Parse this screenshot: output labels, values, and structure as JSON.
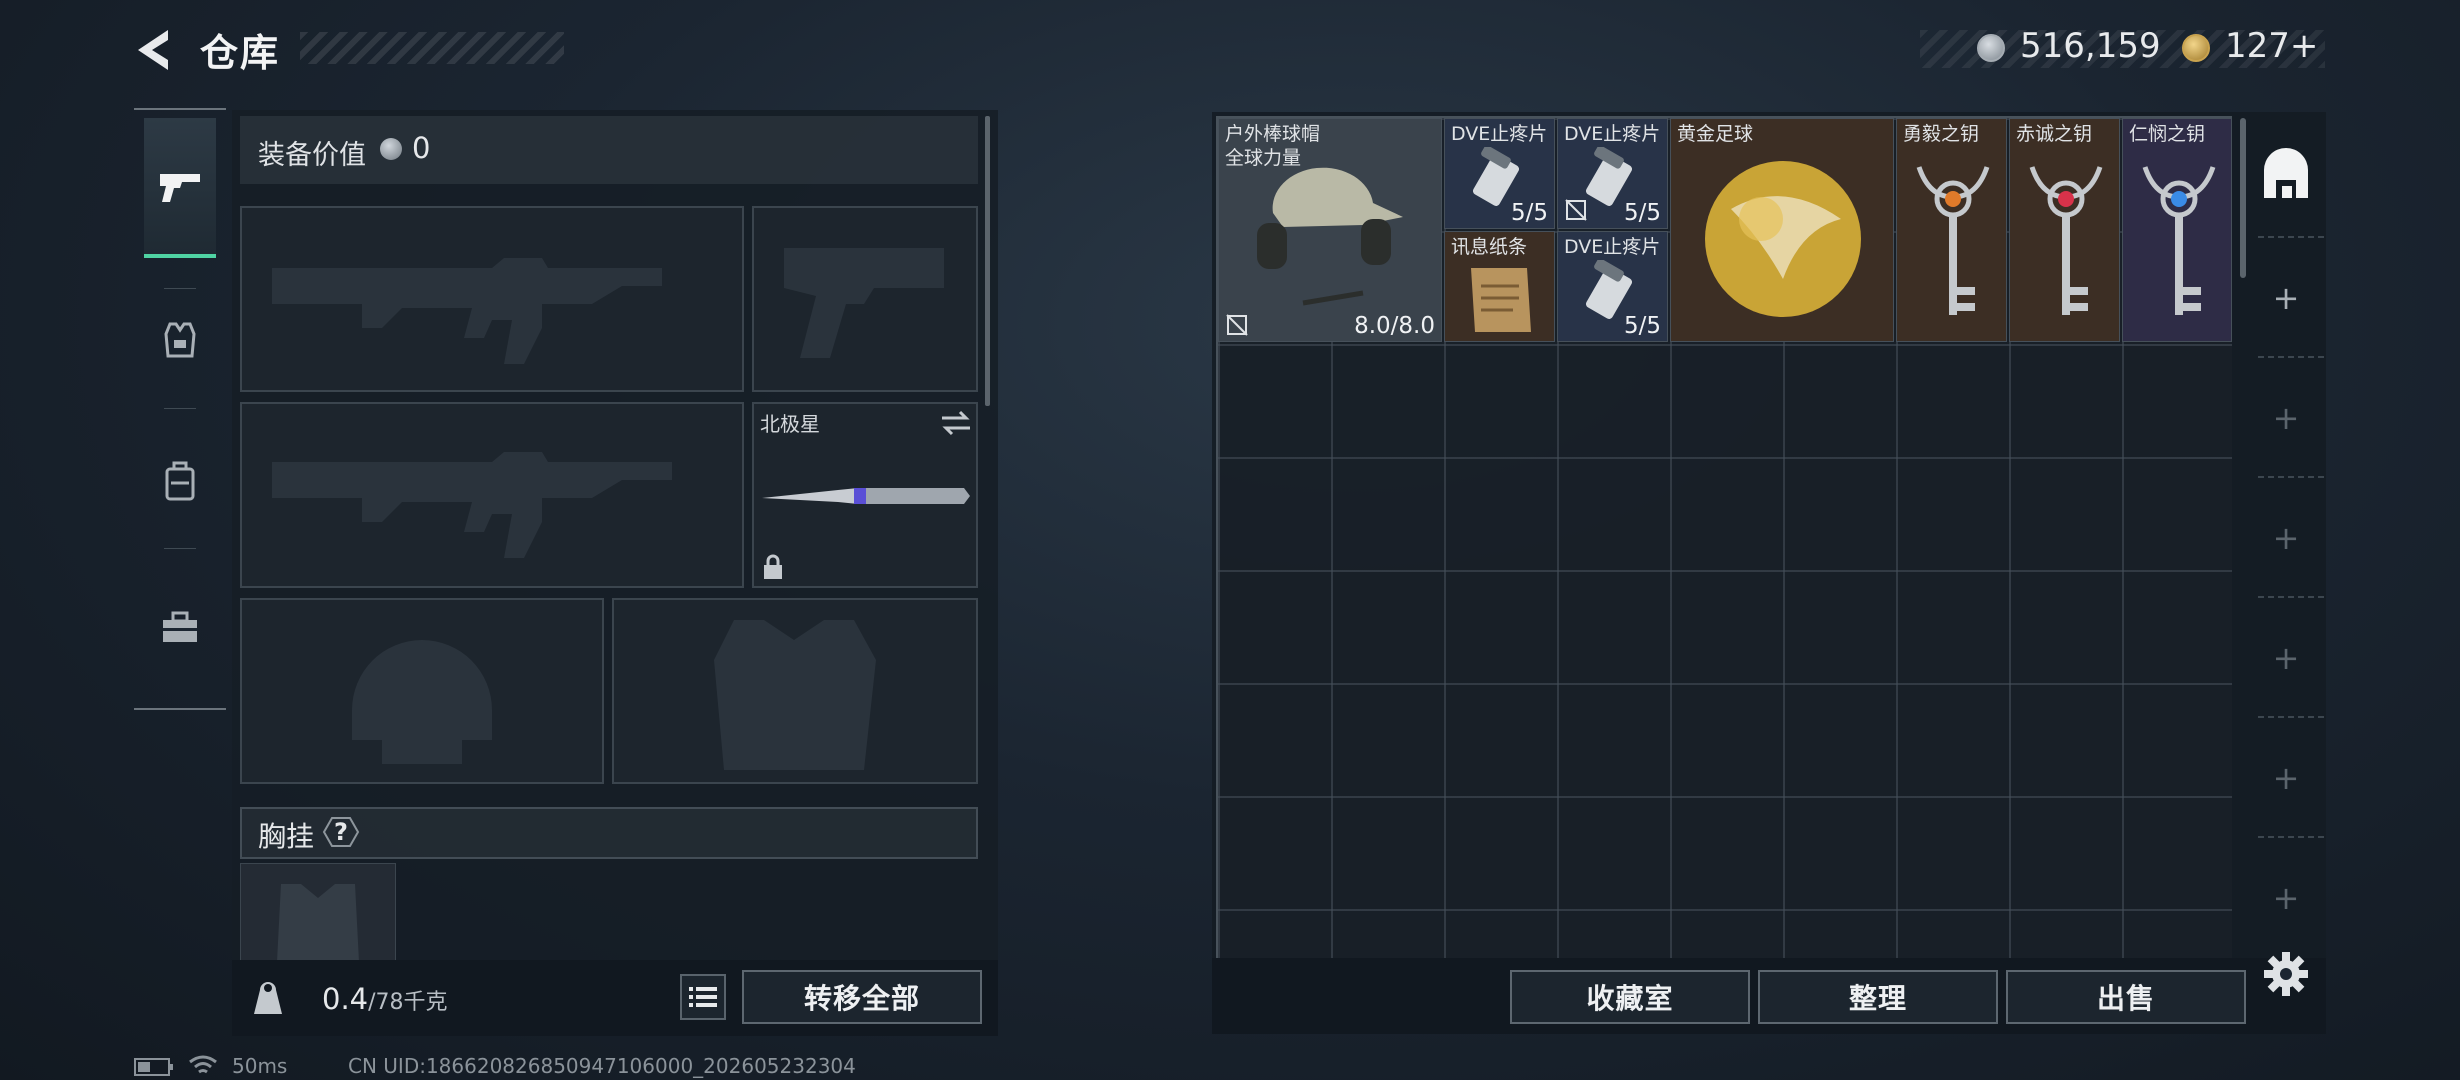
{
  "header": {
    "title": "仓库",
    "silver_amount": "516,159",
    "gold_amount": "127+"
  },
  "equipment": {
    "value_label": "装备价值",
    "value_amount": "0",
    "melee_slot_name": "北极星",
    "chest_label": "胸挂",
    "chest_help": "?",
    "weight_current": "0.4",
    "weight_capacity": "/78千克",
    "transfer_button": "转移全部"
  },
  "storage": {
    "items": [
      {
        "name": "户外棒球帽\n全球力量",
        "count": "8.0/8.0",
        "rarity": "gray",
        "icon": "helmet-headset-icon"
      },
      {
        "name": "DVE止疼片",
        "count": "5/5",
        "rarity": "blue",
        "icon": "pill-bottle-icon"
      },
      {
        "name": "DVE止疼片",
        "count": "5/5",
        "rarity": "blue",
        "icon": "pill-bottle-icon"
      },
      {
        "name": "黄金足球",
        "count": "",
        "rarity": "orange",
        "icon": "gold-soccer-ball-icon"
      },
      {
        "name": "勇毅之钥",
        "count": "",
        "rarity": "orange",
        "icon": "key-orange-gem-icon"
      },
      {
        "name": "赤诚之钥",
        "count": "",
        "rarity": "orange",
        "icon": "key-red-gem-icon"
      },
      {
        "name": "仁悯之钥",
        "count": "",
        "rarity": "purple",
        "icon": "key-blue-gem-icon"
      },
      {
        "name": "讯息纸条",
        "count": "",
        "rarity": "orange",
        "icon": "paper-note-icon"
      },
      {
        "name": "DVE止疼片",
        "count": "5/5",
        "rarity": "blue",
        "icon": "pill-bottle-icon"
      }
    ],
    "buttons": {
      "collection": "收藏室",
      "sort": "整理",
      "sell": "出售"
    },
    "side_plus": "+"
  },
  "footer": {
    "ping": "50ms",
    "uid": "CN UID:18662082685094710600​0_202605232304"
  },
  "colors": {
    "accent_green": "#4fd3a3",
    "rarity_gray": "#3a434c",
    "rarity_blue": "#283348",
    "rarity_purple": "#2e2c46",
    "rarity_orange": "#3c2e24"
  }
}
